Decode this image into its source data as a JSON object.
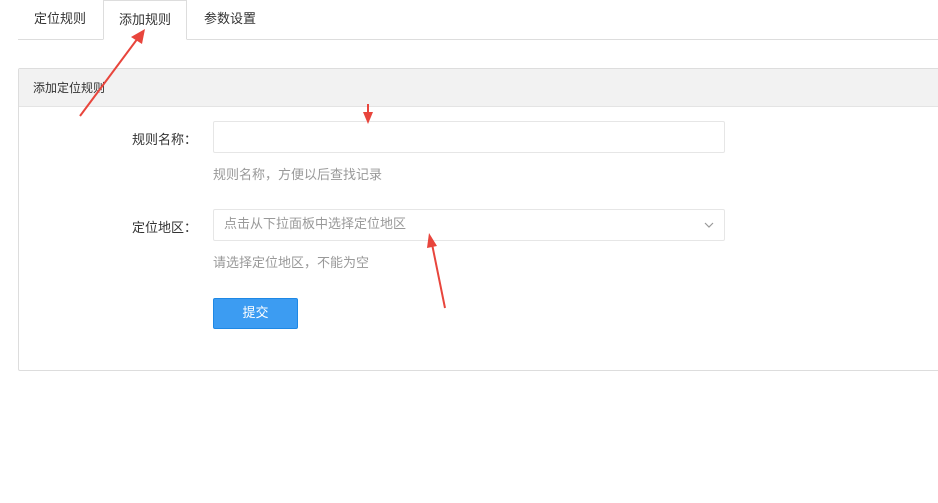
{
  "tabs": [
    {
      "label": "定位规则"
    },
    {
      "label": "添加规则"
    },
    {
      "label": "参数设置"
    }
  ],
  "panel": {
    "title": "添加定位规则"
  },
  "form": {
    "rule_name": {
      "label": "规则名称：",
      "value": "",
      "hint": "规则名称，方便以后查找记录"
    },
    "region": {
      "label": "定位地区：",
      "placeholder": "点击从下拉面板中选择定位地区",
      "hint": "请选择定位地区，不能为空"
    },
    "submit_label": "提交"
  },
  "colors": {
    "primary": "#3c9cf2",
    "annotation": "#e8453c"
  },
  "icons": {
    "select_chevron": "chevron-down-icon"
  }
}
